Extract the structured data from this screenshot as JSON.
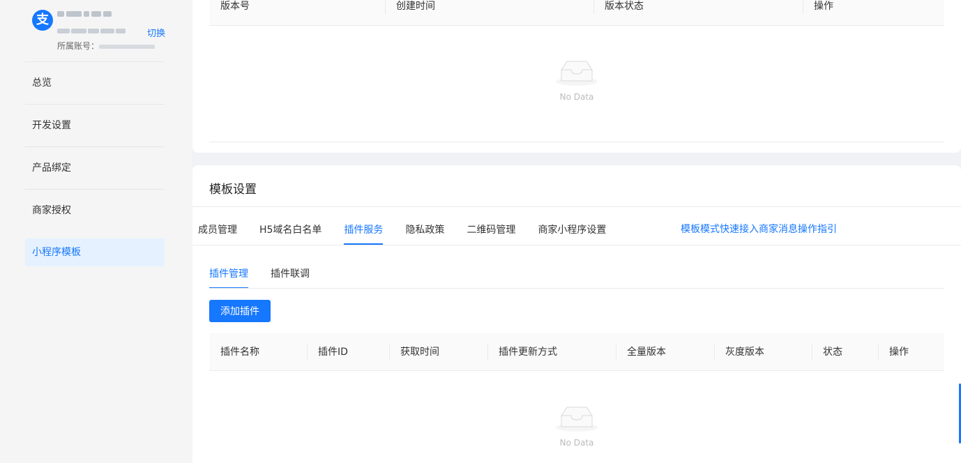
{
  "account": {
    "avatar_glyph": "支",
    "switch_label": "切换",
    "owner_label": "所属账号："
  },
  "menu": {
    "items": [
      "总览",
      "开发设置",
      "产品绑定",
      "商家授权"
    ],
    "active": "小程序模板"
  },
  "version_table": {
    "columns": [
      "版本号",
      "创建时间",
      "版本状态",
      "操作"
    ],
    "empty_text": "No Data"
  },
  "template": {
    "title": "模板设置",
    "tabs": [
      "成员管理",
      "H5域名白名单",
      "插件服务",
      "隐私政策",
      "二维码管理",
      "商家小程序设置"
    ],
    "active_tab": "插件服务",
    "guide_link": "模板模式快速接入商家消息操作指引",
    "subtabs": [
      "插件管理",
      "插件联调"
    ],
    "active_subtab": "插件管理",
    "add_button": "添加插件",
    "plugin_columns": [
      "插件名称",
      "插件ID",
      "获取时间",
      "插件更新方式",
      "全量版本",
      "灰度版本",
      "状态",
      "操作"
    ],
    "empty_text": "No Data"
  },
  "colors": {
    "accent": "#1677ff",
    "active_bg": "#e5f1fe"
  }
}
